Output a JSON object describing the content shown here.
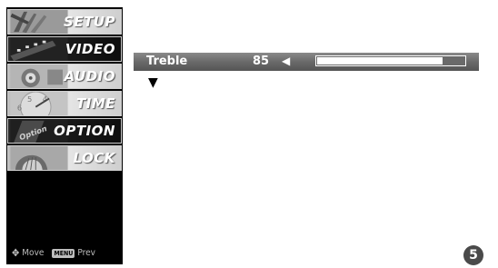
{
  "menu": {
    "items": [
      {
        "label": "SETUP",
        "icon": "setup-icon"
      },
      {
        "label": "VIDEO",
        "icon": "video-icon"
      },
      {
        "label": "AUDIO",
        "icon": "audio-icon"
      },
      {
        "label": "TIME",
        "icon": "time-icon"
      },
      {
        "label": "OPTION",
        "icon": "option-icon"
      },
      {
        "label": "LOCK",
        "icon": "lock-icon"
      }
    ],
    "thumb_text": {
      "option": "Option"
    },
    "nav_move": "Move",
    "nav_menu_key": "MENU",
    "nav_prev": "Prev"
  },
  "treble": {
    "label": "Treble",
    "value": "85",
    "level_percent": 85,
    "arrow": "◀"
  },
  "down_arrow": "▼",
  "page_number": "5"
}
